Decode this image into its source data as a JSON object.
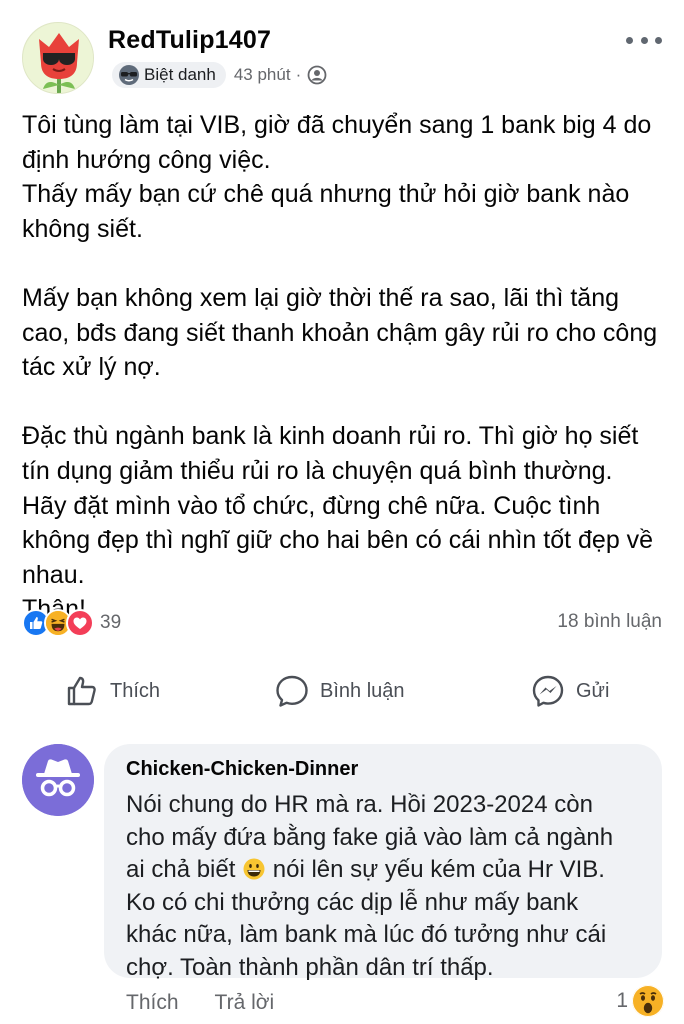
{
  "post": {
    "author": "RedTulip1407",
    "badge_label": "Biệt danh",
    "badge_icon": "sunglasses-icon",
    "time": "43 phút",
    "separator": "·",
    "audience_icon": "friends-icon",
    "paragraphs": [
      [
        "Tôi tùng làm tại VIB, giờ đã chuyển sang 1 bank big 4 do",
        "định hướng công việc.",
        "Thấy mấy bạn cứ chê quá nhưng thử hỏi giờ bank nào",
        "không siết."
      ],
      [
        "Mấy bạn không xem lại giờ thời thế ra sao, lãi thì tăng",
        "cao, bđs đang siết thanh khoản chậm gây rủi ro cho công",
        "tác xử lý nợ."
      ],
      [
        "Đặc thù ngành bank là kinh doanh rủi ro. Thì giờ họ siết",
        "tín dụng giảm thiểu rủi ro là chuyện quá bình thường.",
        "Hãy đặt mình vào tổ chức, đừng chê nữa. Cuộc tình",
        "không đẹp thì nghĩ giữ cho hai bên có cái nhìn tốt đẹp về",
        "nhau.",
        "Thân!"
      ]
    ],
    "reaction_count": "39",
    "comment_count": "18 bình luận"
  },
  "actions": {
    "like": "Thích",
    "comment": "Bình luận",
    "send": "Gửi"
  },
  "comment": {
    "author": "Chicken-Chicken-Dinner",
    "lines": [
      "Nói chung do HR mà ra. Hồi 2023-2024 còn",
      "cho mấy đứa bằng fake giả vào làm cả ngành",
      "ai chả biết",
      "nói lên sự yếu kém của Hr VIB.",
      "Ko có chi thưởng các dịp lễ như mấy bank",
      "khác nữa, làm bank mà lúc đó tưởng như cái",
      "chợ. Toàn thành phần dân trí thấp."
    ],
    "like_label": "Thích",
    "reply_label": "Trả lời",
    "reaction_count": "1"
  },
  "colors": {
    "like_blue": "#1877f2",
    "love_red": "#f33e58",
    "haha_yellow": "#f7b125",
    "muted": "#65676b",
    "bubble": "#f0f2f5"
  }
}
